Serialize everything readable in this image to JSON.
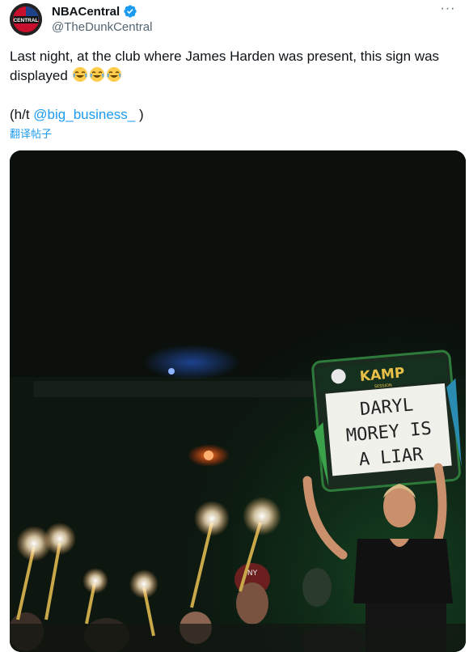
{
  "author": {
    "display_name": "NBACentral",
    "handle": "@TheDunkCentral",
    "avatar_text": "CENTRAL",
    "verified": true
  },
  "tweet": {
    "line1": "Last night, at the club where James Harden was present, this sign was displayed",
    "emoji": [
      "joy-emoji",
      "joy-emoji",
      "joy-emoji"
    ],
    "hat_tip_prefix": "(h/t ",
    "hat_tip_mention": "@big_business_",
    "hat_tip_suffix": " )"
  },
  "translate_label": "翻译帖子",
  "more_label": "···",
  "media": {
    "sign_brand": "KAMP",
    "sign_brand_sub": "SESSION",
    "sign_line1": "DARYL",
    "sign_line2": "MOREY  IS",
    "sign_line3": "A  LIAR",
    "hat_text": "NY"
  },
  "colors": {
    "link": "#1d9bf0",
    "text": "#0f1419",
    "muted": "#536471"
  }
}
